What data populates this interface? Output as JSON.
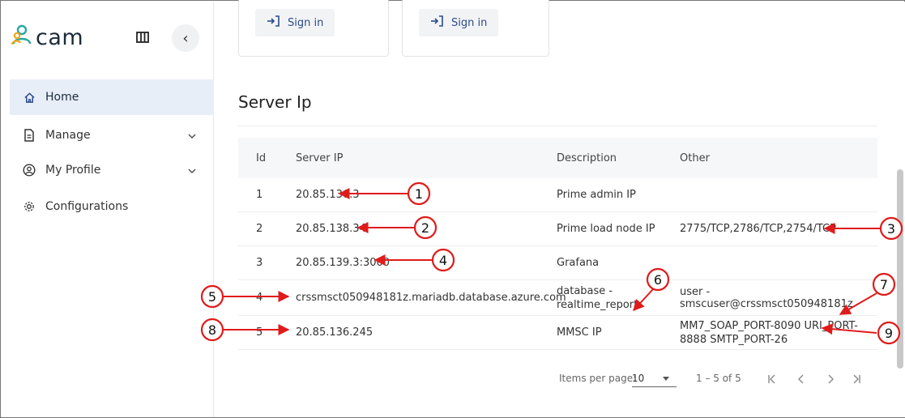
{
  "app": {
    "brand": "cam",
    "colors": {
      "accent": "#2b4a8b",
      "annotation_red": "#e01b1b",
      "logo_orange": "#f2a81d",
      "logo_teal": "#2aa7a1"
    }
  },
  "sidebar": {
    "items": [
      {
        "label": "Home",
        "icon": "home-icon",
        "active": true
      },
      {
        "label": "Manage",
        "icon": "document-icon",
        "expandable": true
      },
      {
        "label": "My Profile",
        "icon": "profile-icon",
        "expandable": true
      },
      {
        "label": "Configurations",
        "icon": "gear-icon"
      }
    ]
  },
  "top_cards": [
    {
      "button_label": "Sign in"
    },
    {
      "button_label": "Sign in"
    }
  ],
  "server_ip": {
    "title": "Server Ip",
    "columns": [
      "Id",
      "Server IP",
      "Description",
      "Other"
    ],
    "rows": [
      {
        "id": "1",
        "ip": "20.85.136.3",
        "desc": "Prime admin IP",
        "other": ""
      },
      {
        "id": "2",
        "ip": "20.85.138.34",
        "desc": "Prime load node IP",
        "other": "2775/TCP,2786/TCP,2754/TCP"
      },
      {
        "id": "3",
        "ip": "20.85.139.3:3000",
        "desc": "Grafana",
        "other": ""
      },
      {
        "id": "4",
        "ip": "crssmsct050948181z.mariadb.database.azure.com",
        "desc_line1": "database -",
        "desc_line2": "realtime_report",
        "other": "user - smscuser@crssmsct050948181z"
      },
      {
        "id": "5",
        "ip": "20.85.136.245",
        "desc": "MMSC IP",
        "other_line1": "MM7_SOAP_PORT-8090 URI_PORT-",
        "other_line2": "8888 SMTP_PORT-26"
      }
    ]
  },
  "paginator": {
    "items_per_page_label": "Items per page:",
    "items_per_page_value": "10",
    "range": "1 – 5 of 5"
  },
  "annotations": [
    "1",
    "2",
    "3",
    "4",
    "5",
    "6",
    "7",
    "8",
    "9"
  ]
}
